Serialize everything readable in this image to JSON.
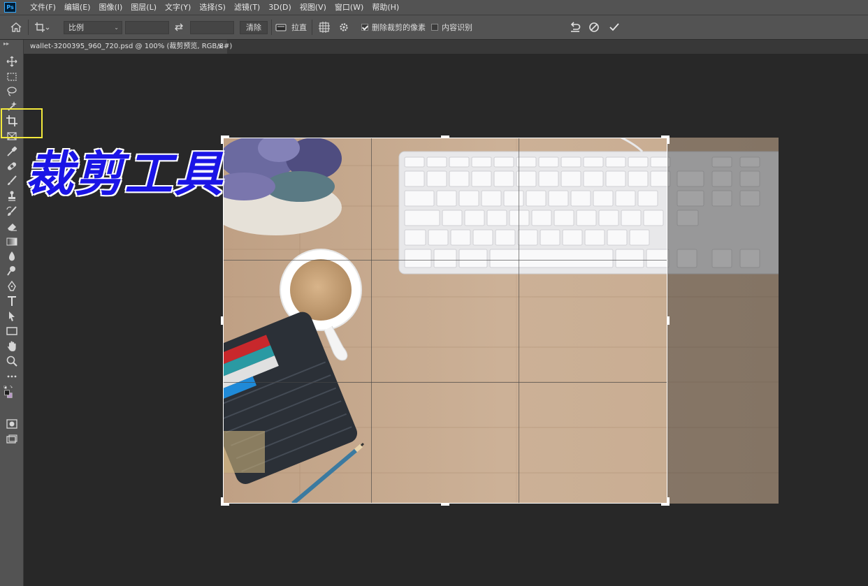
{
  "app": {
    "logo": "Ps"
  },
  "menu": [
    "文件(F)",
    "编辑(E)",
    "图像(I)",
    "图层(L)",
    "文字(Y)",
    "选择(S)",
    "滤镜(T)",
    "3D(D)",
    "视图(V)",
    "窗口(W)",
    "帮助(H)"
  ],
  "options": {
    "ratio_select": "比例",
    "clear_button": "清除",
    "straighten_label": "拉直",
    "delete_cropped_label": "删除裁剪的像素",
    "delete_cropped_checked": true,
    "content_aware_label": "内容识别",
    "content_aware_checked": false
  },
  "tab": {
    "title": "wallet-3200395_960_720.psd @ 100% (裁剪预览, RGB/8#)",
    "close": "×"
  },
  "toolbox": {
    "grip": "▸▸"
  },
  "overlay": {
    "title": "裁剪工具"
  },
  "colors": {
    "highlight": "#f3e93c",
    "title_fill": "#1a14e6",
    "ui_panel": "#535353"
  }
}
